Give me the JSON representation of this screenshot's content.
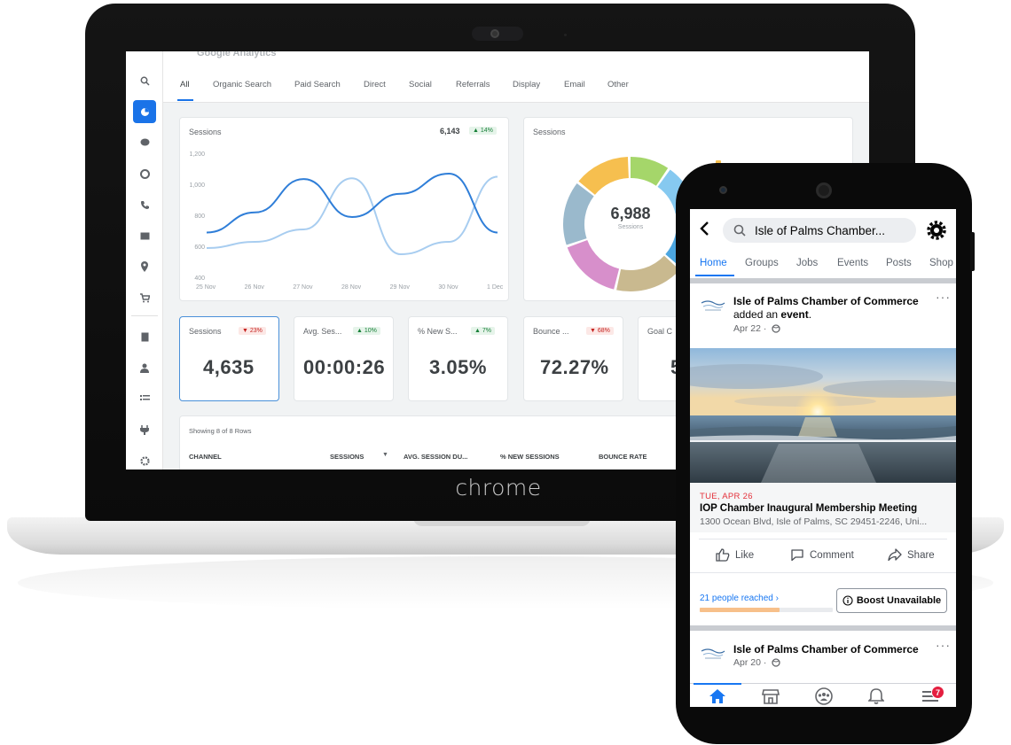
{
  "laptop": {
    "brand_label": "chrome",
    "app": {
      "top_faint": "Google Analytics",
      "tabs": [
        "All",
        "Organic Search",
        "Paid Search",
        "Direct",
        "Social",
        "Referrals",
        "Display",
        "Email",
        "Other"
      ],
      "active_tab": "All",
      "line_chart": {
        "title": "Sessions",
        "total": "6,143",
        "change": "▲ 14%"
      },
      "donut": {
        "title": "Sessions",
        "center_value": "6,988",
        "center_label": "Sessions"
      },
      "metrics": [
        {
          "label": "Sessions",
          "change": "▼ 23%",
          "direction": "down",
          "value": "4,635"
        },
        {
          "label": "Avg. Ses...",
          "change": "▲ 10%",
          "direction": "up",
          "value": "00:00:26"
        },
        {
          "label": "% New S...",
          "change": "▲ 7%",
          "direction": "up",
          "value": "3.05%"
        },
        {
          "label": "Bounce ...",
          "change": "▼ 68%",
          "direction": "down",
          "value": "72.27%"
        },
        {
          "label": "Goal C",
          "change": "",
          "direction": "",
          "value": "5"
        }
      ],
      "table": {
        "showing": "Showing 8 of 8 Rows",
        "headers": [
          "CHANNEL",
          "SESSIONS",
          "AVG. SESSION DU...",
          "% NEW SESSIONS",
          "BOUNCE RATE"
        ]
      }
    }
  },
  "chart_data": {
    "type": "line",
    "title": "Sessions",
    "x": [
      "25 Nov",
      "26 Nov",
      "27 Nov",
      "28 Nov",
      "29 Nov",
      "30 Nov",
      "1 Dec"
    ],
    "yticks": [
      "1,200",
      "1,000",
      "800",
      "600",
      "400"
    ],
    "ylim": [
      400,
      1200
    ],
    "series": [
      {
        "values": [
          700,
          830,
          1045,
          800,
          950,
          1080,
          700
        ],
        "color": "#2f7ed8"
      },
      {
        "values": [
          600,
          640,
          720,
          1050,
          560,
          640,
          1060
        ],
        "color": "#a8cdf0"
      }
    ],
    "grid": false
  },
  "donut_data": {
    "colors": [
      "#f6bf4f",
      "#a5d66a",
      "#86c9f0",
      "#4ca6e0",
      "#c9b98f",
      "#d78fcb",
      "#9ab9cc"
    ],
    "shares": [
      0.14,
      0.1,
      0.12,
      0.15,
      0.17,
      0.16,
      0.16
    ]
  },
  "phone": {
    "search_text": "Isle of Palms Chamber...",
    "tabs": [
      "Home",
      "Groups",
      "Jobs",
      "Events",
      "Posts",
      "Shop"
    ],
    "active_tab": "Home",
    "post1": {
      "page_name": "Isle of Palms Chamber of Commerce",
      "action_prefix": "added an ",
      "action_bold": "event",
      "action_suffix": ".",
      "date": "Apr 22 ·",
      "event_date": "TUE, APR 26",
      "event_title": "IOP Chamber Inaugural Membership Meeting",
      "event_location": "1300 Ocean Blvd, Isle of Palms, SC 29451-2246, Uni..."
    },
    "actions": {
      "like": "Like",
      "comment": "Comment",
      "share": "Share"
    },
    "reach": {
      "label": "21 people reached",
      "fraction": 0.6
    },
    "boost_label": "Boost Unavailable",
    "post2": {
      "page_name": "Isle of Palms Chamber of Commerce",
      "date": "Apr 20 ·"
    },
    "notification_badge": "7",
    "colors": {
      "accent": "#1877f2",
      "event_red": "#e4313b",
      "reach_bar": "#f7c08a"
    }
  }
}
